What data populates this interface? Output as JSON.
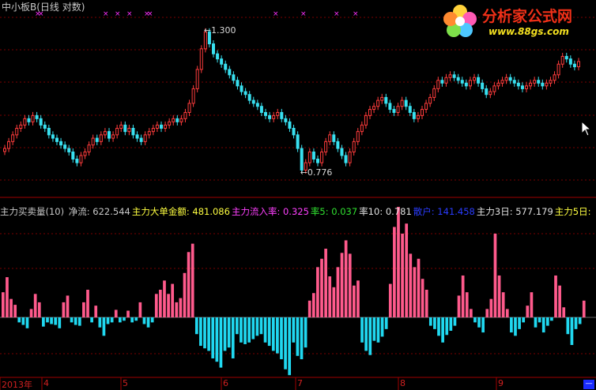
{
  "chart_title": "中小板B(日线 对数)",
  "logo": {
    "name": "分析家公式网",
    "url": "www.88gs.com"
  },
  "price_panel": {
    "high_label": "1.300",
    "low_label": "0.776",
    "high_value": 1.3,
    "low_value": 0.776
  },
  "indicator": {
    "name": "主力买卖量(10)",
    "items": [
      {
        "label": "净流:",
        "value": "622.544",
        "color": "#c8c8c8"
      },
      {
        "label": "主力大单金额:",
        "value": "481.086",
        "color": "#ffff40"
      },
      {
        "label": "主力流入率:",
        "value": "0.325",
        "color": "#ff40ff"
      },
      {
        "label": "率5:",
        "value": "0.037",
        "color": "#30e030"
      },
      {
        "label": "率10:",
        "value": "0.781",
        "color": "#e0e0e0"
      },
      {
        "label": "散户:",
        "value": "141.458",
        "color": "#2a3cff"
      },
      {
        "label": "主力3日:",
        "value": "577.179",
        "color": "#e0e0e0"
      },
      {
        "label": "主力5日:",
        "value": "",
        "color": "#ffff40"
      }
    ]
  },
  "x_axis": {
    "labels": [
      {
        "text": "2013年",
        "x": 2
      },
      {
        "text": "4",
        "x": 55
      },
      {
        "text": "5",
        "x": 155
      },
      {
        "text": "6",
        "x": 282
      },
      {
        "text": "7",
        "x": 376
      },
      {
        "text": "8",
        "x": 506
      },
      {
        "text": "9",
        "x": 630
      }
    ]
  },
  "colors": {
    "up": "#ff3c3c",
    "down": "#38e0f0",
    "bar_pos": "#ff5a8c",
    "bar_neg": "#20d8f0",
    "grid": "#7a0000",
    "marker": "#ff30ff"
  },
  "chart_data": [
    {
      "type": "candlestick",
      "title": "中小板B(日线 对数)",
      "annotations": [
        "1.300",
        "0.776"
      ],
      "ylim": [
        0.74,
        1.34
      ],
      "close": [
        0.86,
        0.88,
        0.9,
        0.92,
        0.93,
        0.95,
        0.94,
        0.96,
        0.95,
        0.93,
        0.92,
        0.9,
        0.89,
        0.88,
        0.87,
        0.86,
        0.85,
        0.83,
        0.82,
        0.84,
        0.85,
        0.87,
        0.89,
        0.88,
        0.9,
        0.91,
        0.89,
        0.9,
        0.92,
        0.93,
        0.91,
        0.92,
        0.9,
        0.89,
        0.88,
        0.9,
        0.91,
        0.92,
        0.93,
        0.92,
        0.93,
        0.94,
        0.95,
        0.94,
        0.95,
        0.97,
        1.0,
        1.05,
        1.12,
        1.2,
        1.27,
        1.22,
        1.18,
        1.16,
        1.14,
        1.12,
        1.1,
        1.08,
        1.06,
        1.04,
        1.03,
        1.01,
        1.0,
        0.99,
        0.97,
        0.96,
        0.95,
        0.96,
        0.97,
        0.95,
        0.94,
        0.92,
        0.9,
        0.86,
        0.8,
        0.82,
        0.85,
        0.83,
        0.82,
        0.85,
        0.88,
        0.9,
        0.88,
        0.86,
        0.84,
        0.82,
        0.85,
        0.88,
        0.91,
        0.93,
        0.96,
        0.98,
        0.99,
        1.01,
        1.02,
        1.0,
        0.98,
        0.97,
        0.99,
        1.01,
        0.99,
        0.97,
        0.95,
        0.96,
        0.98,
        1.0,
        1.02,
        1.05,
        1.08,
        1.07,
        1.09,
        1.1,
        1.09,
        1.08,
        1.07,
        1.06,
        1.08,
        1.09,
        1.07,
        1.05,
        1.03,
        1.04,
        1.06,
        1.07,
        1.08,
        1.09,
        1.08,
        1.07,
        1.06,
        1.05,
        1.06,
        1.07,
        1.08,
        1.07,
        1.06,
        1.07,
        1.08,
        1.1,
        1.14,
        1.17,
        1.16,
        1.14,
        1.13,
        1.15
      ]
    },
    {
      "type": "bar",
      "title": "主力买卖量(10)",
      "values": [
        30,
        48,
        22,
        15,
        -6,
        -9,
        -13,
        10,
        28,
        18,
        -11,
        -6,
        -8,
        -9,
        -13,
        18,
        26,
        -6,
        -9,
        -10,
        18,
        33,
        -6,
        14,
        -12,
        -22,
        -8,
        -6,
        9,
        -6,
        -4,
        8,
        -6,
        -4,
        18,
        -8,
        -12,
        -6,
        28,
        33,
        44,
        28,
        40,
        18,
        23,
        53,
        78,
        88,
        -20,
        -34,
        -37,
        -40,
        -49,
        -53,
        -60,
        -40,
        -36,
        -49,
        -20,
        -30,
        -32,
        -30,
        -26,
        -22,
        -20,
        -30,
        -34,
        -40,
        -43,
        -50,
        -62,
        -69,
        -30,
        -46,
        -50,
        -36,
        20,
        29,
        60,
        70,
        82,
        49,
        36,
        60,
        77,
        92,
        76,
        38,
        44,
        -30,
        -40,
        -45,
        -28,
        -30,
        -23,
        -14,
        40,
        108,
        132,
        100,
        112,
        76,
        60,
        70,
        46,
        33,
        -10,
        -14,
        -22,
        -30,
        -21,
        -16,
        -10,
        26,
        50,
        30,
        10,
        -6,
        -12,
        -18,
        10,
        22,
        100,
        50,
        30,
        10,
        -18,
        -22,
        -14,
        -6,
        14,
        30,
        -12,
        -6,
        -18,
        -10,
        -4,
        50,
        38,
        12,
        -20,
        -33,
        -14,
        -8,
        20
      ]
    }
  ]
}
